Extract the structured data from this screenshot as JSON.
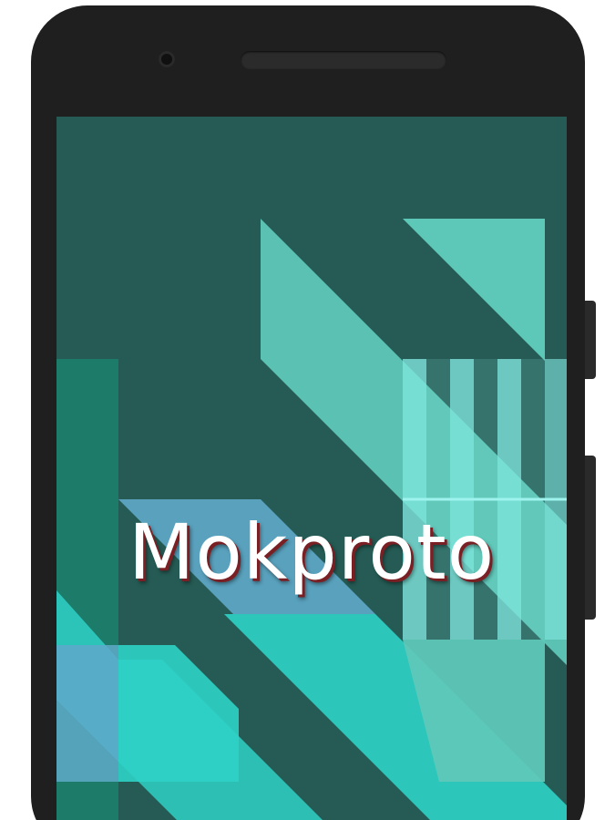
{
  "app": {
    "title": "Mokproto"
  },
  "device": {
    "type": "phone-mockup",
    "frame_color": "#1f1f1f"
  },
  "splash": {
    "background_color": "#255b54",
    "accent_colors": [
      "#5ec8b8",
      "#7fe6dc",
      "#2fd1c6",
      "#1d7b6a",
      "#5fa9c9"
    ],
    "title_shadow_color": "#7a1f23"
  }
}
